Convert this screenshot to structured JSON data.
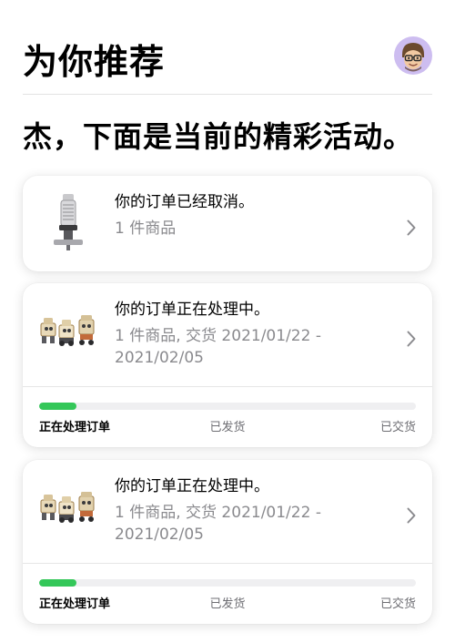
{
  "header": {
    "title": "为你推荐"
  },
  "headline": "杰，下面是当前的精彩活动。",
  "orders": [
    {
      "title": "你的订单已经取消。",
      "subtitle": "1 件商品",
      "thumbnail": "microphone-image"
    },
    {
      "title": "你的订单正在处理中。",
      "subtitle": "1 件商品, 交货 2021/01/22 - 2021/02/05",
      "thumbnail": "robot-kits-image",
      "progress_percent": 10,
      "steps": [
        "正在处理订单",
        "已发货",
        "已交货"
      ]
    },
    {
      "title": "你的订单正在处理中。",
      "subtitle": "1 件商品, 交货 2021/01/22 - 2021/02/05",
      "thumbnail": "robot-kits-image",
      "progress_percent": 10,
      "steps": [
        "正在处理订单",
        "已发货",
        "已交货"
      ]
    }
  ],
  "colors": {
    "progress": "#34c759",
    "avatar_bg": "#cdbdf0",
    "secondary_text": "#8a8a8e"
  }
}
